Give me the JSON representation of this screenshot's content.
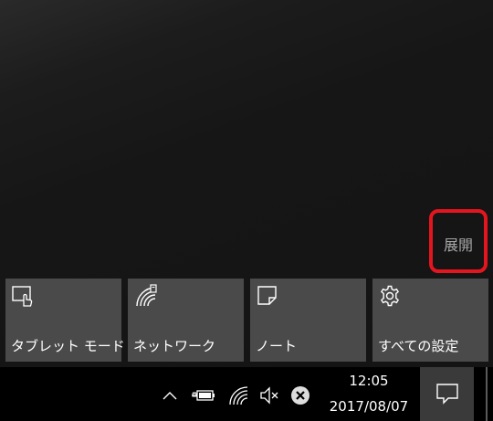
{
  "action_center": {
    "expand_label": "展開",
    "tiles": [
      {
        "label": "タブレット モード",
        "icon": "tablet-mode-icon"
      },
      {
        "label": "ネットワーク",
        "icon": "network-icon"
      },
      {
        "label": "ノート",
        "icon": "note-icon"
      },
      {
        "label": "すべての設定",
        "icon": "settings-icon"
      }
    ]
  },
  "taskbar": {
    "time": "12:05",
    "date": "2017/08/07",
    "tray_icons": [
      "show-hidden-icons-chevron-icon",
      "battery-icon",
      "wifi-icon",
      "volume-muted-icon",
      "close-circle-icon"
    ],
    "action_center_icon": "notification-icon"
  },
  "colors": {
    "tile_background": "#4a4a4a",
    "highlight_border": "#e4151f",
    "expand_text": "#a7a7a7",
    "taskbar": "#000000"
  }
}
